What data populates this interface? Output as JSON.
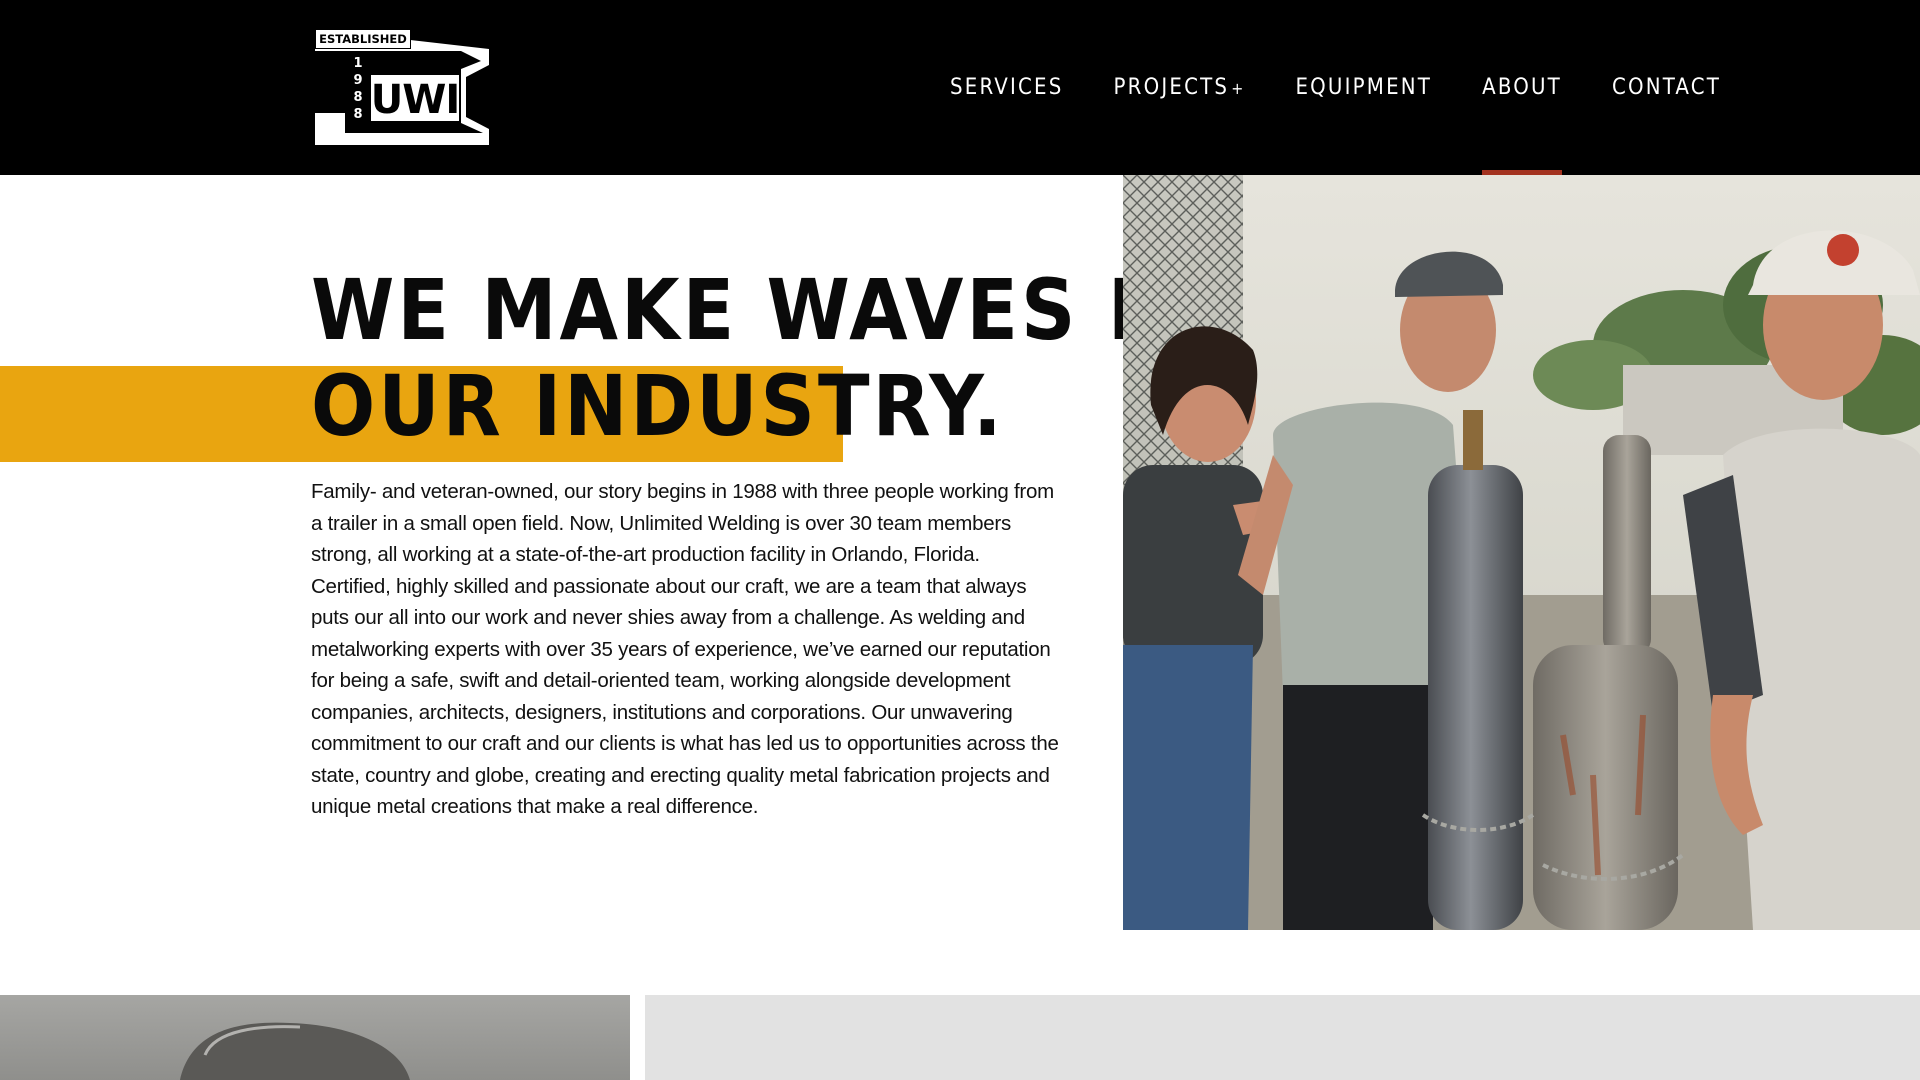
{
  "header": {
    "logo": {
      "established_label": "ESTABLISHED",
      "year_digits": [
        "1",
        "9",
        "8",
        "8"
      ],
      "mark": "UWI"
    },
    "nav": [
      {
        "label": "SERVICES",
        "has_submenu": false,
        "active": false
      },
      {
        "label": "PROJECTS",
        "has_submenu": true,
        "submenu_indicator": "+",
        "active": false
      },
      {
        "label": "EQUIPMENT",
        "has_submenu": false,
        "active": false
      },
      {
        "label": "ABOUT",
        "has_submenu": false,
        "active": true
      },
      {
        "label": "CONTACT",
        "has_submenu": false,
        "active": false
      }
    ]
  },
  "hero": {
    "title_line1": "WE MAKE WAVES IN",
    "title_line2": "OUR INDUSTRY.",
    "body": "Family- and veteran-owned, our story begins in 1988 with three people working from a trailer in a small open field. Now, Unlimited Welding is over 30 team members strong, all working at a state-of-the-art production facility in Orlando, Florida. Certified, highly skilled and passionate about our craft, we are a team that always puts our all into our work and never shies away from a challenge. As welding and metalworking experts with over 35 years of experience, we’ve earned our reputation for being a safe, swift and detail-oriented team, working alongside development companies, architects, designers, institutions and corporations. Our unwavering commitment to our craft and our clients is what has led us to opportunities across the state, country and globe, creating and erecting quality metal fabrication projects and unique metal creations that make a real difference."
  },
  "colors": {
    "header_bg": "#000000",
    "highlight": "#e9a510",
    "active_underline": "#a3321f",
    "bottom_panel": "#e2e2e2"
  }
}
